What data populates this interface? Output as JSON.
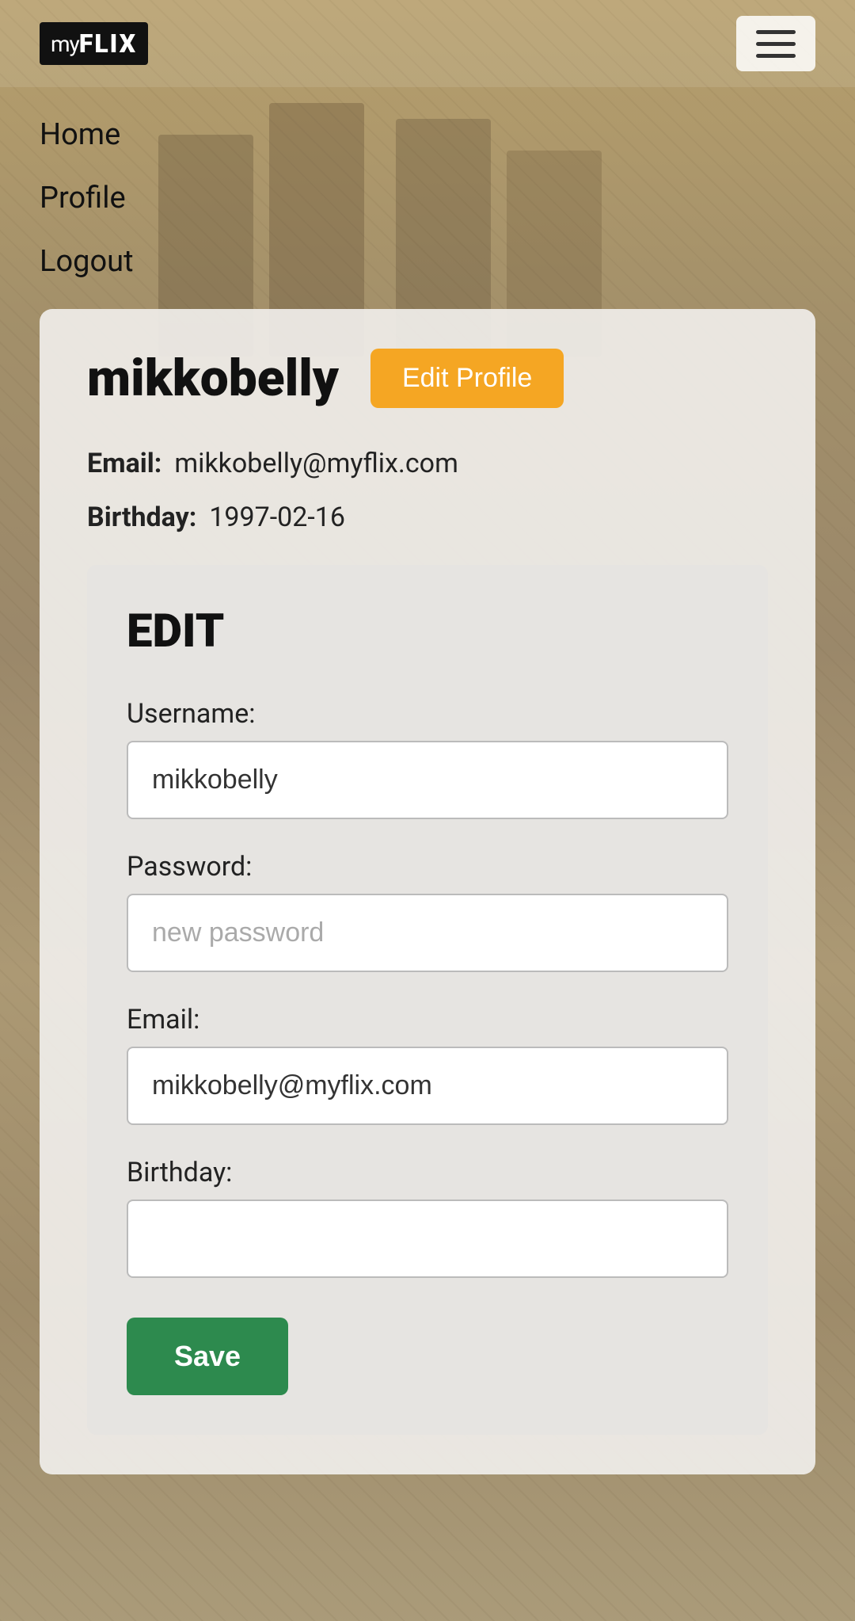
{
  "app": {
    "logo_my": "my",
    "logo_flix": "FLIX"
  },
  "nav": {
    "items": [
      {
        "label": "Home",
        "id": "home"
      },
      {
        "label": "Profile",
        "id": "profile"
      },
      {
        "label": "Logout",
        "id": "logout"
      }
    ]
  },
  "profile": {
    "username": "mikkobelly",
    "edit_button_label": "Edit Profile",
    "email_label": "Email:",
    "email_value": "mikkobelly@myflix.com",
    "birthday_label": "Birthday:",
    "birthday_value": "1997-02-16"
  },
  "edit_form": {
    "title": "EDIT",
    "username_label": "Username:",
    "username_value": "mikkobelly",
    "password_label": "Password:",
    "password_placeholder": "new password",
    "email_label": "Email:",
    "email_value": "mikkobelly@myflix.com",
    "birthday_label": "Birthday:",
    "birthday_value": "",
    "submit_label": "Save"
  },
  "colors": {
    "accent_orange": "#f5a623",
    "accent_green": "#2d8a4e",
    "text_dark": "#111111"
  }
}
